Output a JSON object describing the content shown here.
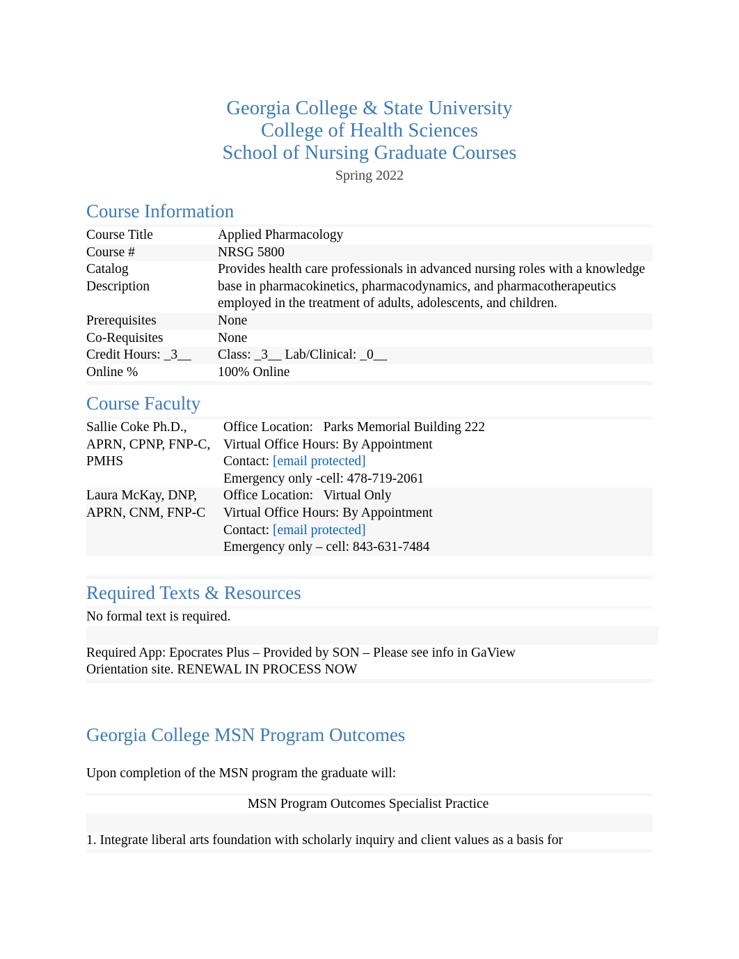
{
  "document": {
    "title_lines": [
      "Georgia College & State University",
      "College of Health Sciences",
      "School of Nursing Graduate Courses"
    ],
    "term": "Spring 2022",
    "colors": {
      "heading_blue": "#3A7AB8",
      "link_blue": "#0563C1",
      "subtitle_gray": "#434343",
      "row_band": "#f7f7f7"
    }
  },
  "course_information": {
    "heading": "Course Information",
    "rows": [
      {
        "label": "Course Title",
        "value": "Applied Pharmacology"
      },
      {
        "label": "Course #",
        "value": "NRSG 5800"
      },
      {
        "label": "Catalog",
        "label2": "Description",
        "value": "Provides health care professionals in advanced nursing roles with a knowledge base in pharmacokinetics, pharmacodynamics, and pharmacotherapeutics employed in the treatment of adults, adolescents, and children."
      },
      {
        "label": "Prerequisites",
        "value": "None"
      },
      {
        "label": "Co-Requisites",
        "value": "None"
      },
      {
        "label": "Credit Hours: _3__",
        "value": "Class: _3__    Lab/Clinical: _0__"
      },
      {
        "label": "Online %",
        "value": "100% Online"
      }
    ]
  },
  "course_faculty": {
    "heading": "Course Faculty",
    "members": [
      {
        "name": "Sallie Coke Ph.D., APRN, CPNP, FNP-C, PMHS",
        "office_location_label": "Office Location:",
        "office_location": "Parks Memorial Building 222",
        "office_hours_label": "Virtual Office Hours:",
        "office_hours": "By Appointment",
        "contact_label": "Contact:",
        "contact_email": "[email protected]",
        "emergency": "Emergency only -cell: 478-719-2061"
      },
      {
        "name": "Laura McKay, DNP, APRN, CNM, FNP-C",
        "office_location_label": "Office Location:",
        "office_location": "Virtual Only",
        "office_hours_label": "Virtual Office Hours:",
        "office_hours": "By Appointment",
        "contact_label": "Contact:",
        "contact_email": "[email protected]",
        "emergency": "Emergency only – cell: 843-631-7484"
      }
    ]
  },
  "required_texts": {
    "heading": "Required Texts & Resources",
    "rows": [
      {
        "text": "No formal text is required.",
        "second_col": ""
      },
      {
        "text": "Required App: Epocrates Plus – Provided by SON – Please see info in GaView Orientation site.    RENEWAL IN PROCESS NOW",
        "second_col": ""
      }
    ]
  },
  "msn_outcomes": {
    "heading": "Georgia College MSN Program Outcomes",
    "intro": "Upon completion of the MSN program the graduate will:",
    "table_header": "MSN Program Outcomes Specialist Practice",
    "items": [
      "1. Integrate liberal arts foundation with scholarly inquiry and client values as a basis for"
    ]
  }
}
